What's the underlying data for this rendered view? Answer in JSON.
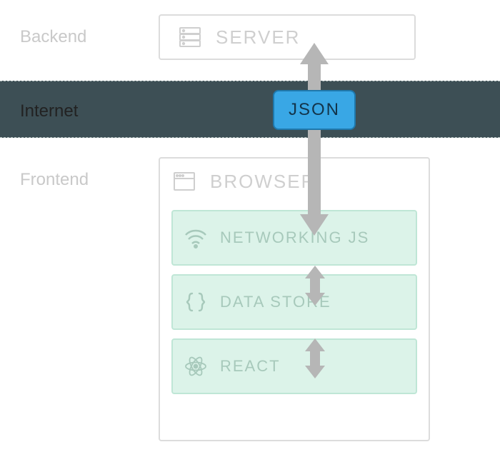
{
  "labels": {
    "backend": "Backend",
    "internet": "Internet",
    "frontend": "Frontend"
  },
  "server": {
    "title": "SERVER"
  },
  "json_pill": "JSON",
  "browser": {
    "title": "BROWSER",
    "layers": {
      "networking": "NETWORKING JS",
      "datastore": "DATA STORE",
      "react": "REACT"
    }
  },
  "colors": {
    "muted": "#cfcfcf",
    "band": "#3d4f55",
    "layer_bg": "#dcf3e9",
    "layer_border": "#bfe6d6",
    "layer_text": "#a7c9bb",
    "json_bg": "#39a7e5",
    "json_border": "#1f78ac",
    "arrow": "#b6b6b6"
  }
}
